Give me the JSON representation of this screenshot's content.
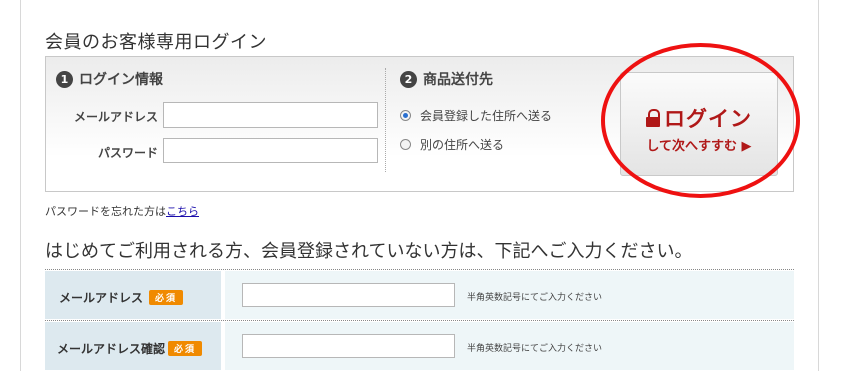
{
  "member_login": {
    "title": "会員のお客様専用ログイン",
    "section1": {
      "number": "1",
      "title": "ログイン情報"
    },
    "email_label": "メールアドレス",
    "email_value": "",
    "password_label": "パスワード",
    "password_value": "",
    "section2": {
      "number": "2",
      "title": "商品送付先"
    },
    "shipping_options": [
      {
        "label": "会員登録した住所へ送る",
        "selected": true
      },
      {
        "label": "別の住所へ送る",
        "selected": false
      }
    ],
    "login_button": {
      "main": "ログイン",
      "sub": "して次へすすむ ▶",
      "icon": "lock-icon"
    },
    "forgot_text": "パスワードを忘れた方は",
    "forgot_link": "こちら"
  },
  "registration": {
    "title": "はじめてご利用される方、会員登録されていない方は、下記へご入力ください。",
    "rows": [
      {
        "label": "メールアドレス",
        "badge": "必須",
        "value": "",
        "hint": "半角英数記号にてご入力ください"
      },
      {
        "label": "メールアドレス確認",
        "badge": "必須",
        "value": "",
        "hint": "半角英数記号にてご入力ください"
      }
    ]
  },
  "colors": {
    "accent_red": "#b01818",
    "annotation_circle": "#ee1111",
    "badge_orange": "#f08a00",
    "row_head_bg": "#dde9ef",
    "row_cell_bg": "#eef6f8"
  }
}
